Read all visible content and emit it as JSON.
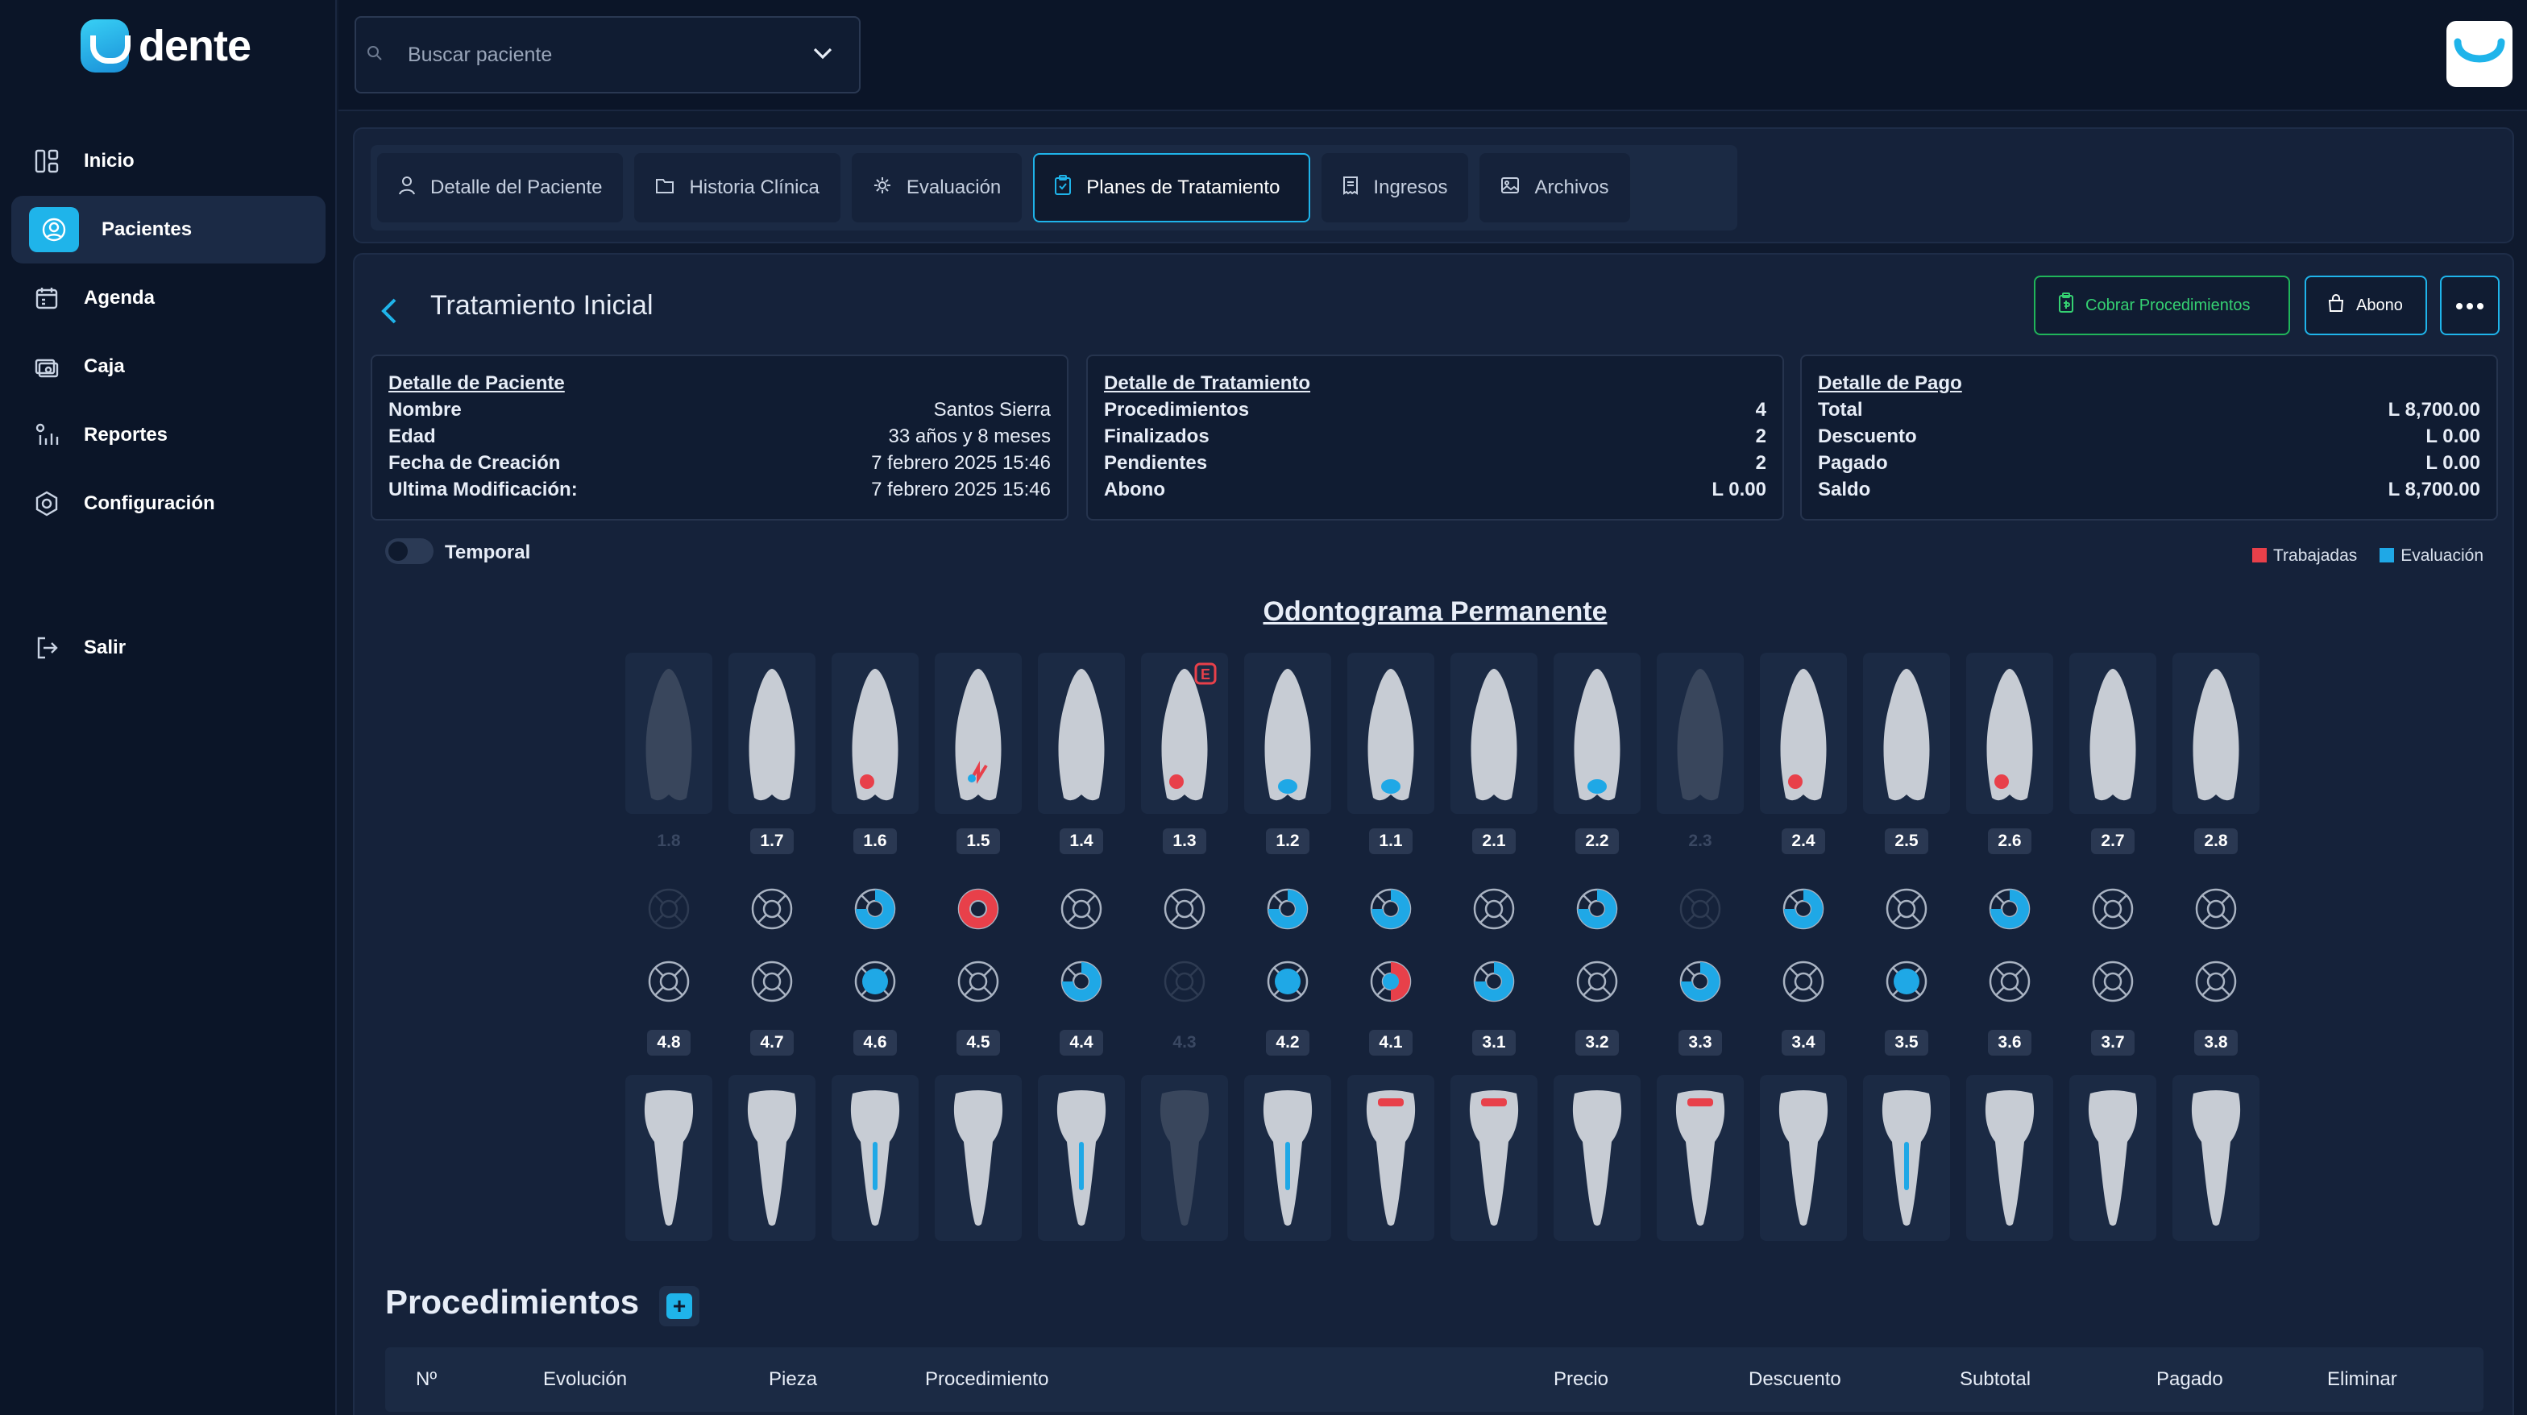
{
  "app": {
    "logo_text": "dente"
  },
  "sidebar": {
    "items": [
      {
        "label": "Inicio",
        "icon": "grid-icon",
        "active": false
      },
      {
        "label": "Pacientes",
        "icon": "user-circle-icon",
        "active": true
      },
      {
        "label": "Agenda",
        "icon": "calendar-icon",
        "active": false
      },
      {
        "label": "Caja",
        "icon": "cash-icon",
        "active": false
      },
      {
        "label": "Reportes",
        "icon": "reports-icon",
        "active": false
      },
      {
        "label": "Configuración",
        "icon": "settings-icon",
        "active": false
      }
    ],
    "logout": {
      "label": "Salir",
      "icon": "logout-icon"
    }
  },
  "topbar": {
    "search_placeholder": "Buscar paciente"
  },
  "tabs": [
    {
      "label": "Detalle del Paciente",
      "icon": "user-icon",
      "active": false
    },
    {
      "label": "Historia Clínica",
      "icon": "folder-icon",
      "active": false
    },
    {
      "label": "Evaluación",
      "icon": "gear-icon",
      "active": false
    },
    {
      "label": "Planes de Tratamiento",
      "icon": "clipboard-icon",
      "active": true
    },
    {
      "label": "Ingresos",
      "icon": "receipt-icon",
      "active": false
    },
    {
      "label": "Archivos",
      "icon": "image-icon",
      "active": false
    }
  ],
  "plan": {
    "title": "Tratamiento Inicial",
    "cobrar_label": "Cobrar Procedimientos",
    "abono_label": "Abono"
  },
  "patient_card": {
    "title": "Detalle de Paciente",
    "rows": [
      {
        "k": "Nombre",
        "v": "Santos Sierra"
      },
      {
        "k": "Edad",
        "v": "33 años y 8 meses"
      },
      {
        "k": "Fecha de Creación",
        "v": "7 febrero 2025 15:46"
      },
      {
        "k": "Ultima Modificación:",
        "v": "7 febrero 2025 15:46"
      }
    ]
  },
  "treatment_card": {
    "title": "Detalle de Tratamiento",
    "rows": [
      {
        "k": "Procedimientos",
        "v": "4"
      },
      {
        "k": "Finalizados",
        "v": "2"
      },
      {
        "k": "Pendientes",
        "v": "2"
      },
      {
        "k": "Abono",
        "v": "L 0.00"
      }
    ]
  },
  "payment_card": {
    "title": "Detalle de Pago",
    "rows": [
      {
        "k": "Total",
        "v": "L 8,700.00"
      },
      {
        "k": "Descuento",
        "v": "L 0.00"
      },
      {
        "k": "Pagado",
        "v": "L 0.00"
      },
      {
        "k": "Saldo",
        "v": "L 8,700.00"
      }
    ]
  },
  "temporal": {
    "label": "Temporal",
    "on": false
  },
  "legend": {
    "trabajadas": {
      "label": "Trabajadas",
      "color": "#e8404a"
    },
    "evaluacion": {
      "label": "Evaluación",
      "color": "#1fa8e6"
    }
  },
  "odontogram": {
    "title": "Odontograma Permanente",
    "upper": [
      {
        "num": "1.8",
        "missing": true,
        "mark": null
      },
      {
        "num": "1.7",
        "mark": null
      },
      {
        "num": "1.6",
        "mark": "red"
      },
      {
        "num": "1.5",
        "mark": "red-blue"
      },
      {
        "num": "1.4",
        "mark": null
      },
      {
        "num": "1.3",
        "mark": "red",
        "badge": "E"
      },
      {
        "num": "1.2",
        "mark": "blue"
      },
      {
        "num": "1.1",
        "mark": "blue"
      },
      {
        "num": "2.1",
        "mark": null
      },
      {
        "num": "2.2",
        "mark": "blue"
      },
      {
        "num": "2.3",
        "missing": true,
        "mark": null
      },
      {
        "num": "2.4",
        "mark": "red"
      },
      {
        "num": "2.5",
        "mark": null
      },
      {
        "num": "2.6",
        "mark": "red"
      },
      {
        "num": "2.7",
        "mark": null
      },
      {
        "num": "2.8",
        "mark": null
      }
    ],
    "upper_circles": [
      "dim",
      "empty",
      "blue-ring",
      "red-ring",
      "empty",
      "empty",
      "blue-ring",
      "blue-ring",
      "empty",
      "blue-ring",
      "dim",
      "blue-ring",
      "empty",
      "blue-ring",
      "empty",
      "empty"
    ],
    "lower_circles": [
      "empty",
      "empty",
      "blue-center",
      "empty",
      "blue-ring",
      "dim",
      "blue-center",
      "red-blue",
      "blue-ring",
      "empty",
      "blue-ring",
      "empty",
      "blue-center",
      "empty",
      "empty",
      "empty"
    ],
    "lower": [
      {
        "num": "4.8",
        "mark": null
      },
      {
        "num": "4.7",
        "mark": null
      },
      {
        "num": "4.6",
        "mark": "blue"
      },
      {
        "num": "4.5",
        "mark": null
      },
      {
        "num": "4.4",
        "mark": "blue"
      },
      {
        "num": "4.3",
        "missing": true,
        "mark": null
      },
      {
        "num": "4.2",
        "mark": "blue"
      },
      {
        "num": "4.1",
        "mark": "red"
      },
      {
        "num": "3.1",
        "mark": "red"
      },
      {
        "num": "3.2",
        "mark": null
      },
      {
        "num": "3.3",
        "mark": "red"
      },
      {
        "num": "3.4",
        "mark": null
      },
      {
        "num": "3.5",
        "mark": "blue"
      },
      {
        "num": "3.6",
        "mark": null
      },
      {
        "num": "3.7",
        "mark": null
      },
      {
        "num": "3.8",
        "mark": null
      }
    ]
  },
  "procedures": {
    "title": "Procedimientos",
    "columns": [
      "Nº",
      "Evolución",
      "Pieza",
      "Procedimiento",
      "Precio",
      "Descuento",
      "Subtotal",
      "Pagado",
      "Eliminar"
    ]
  }
}
